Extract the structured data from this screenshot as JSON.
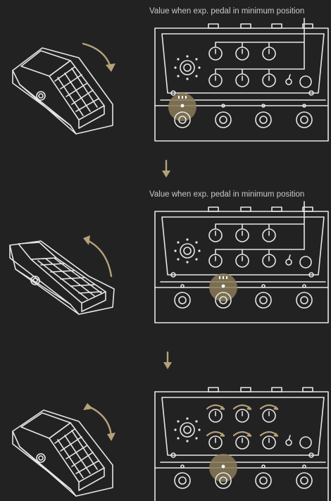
{
  "captions": [
    "Value when exp. pedal in minimum position",
    "Value when exp. pedal in minimum position"
  ],
  "colors": {
    "background": "#222222",
    "line": "#e6e6e6",
    "accent": "#b5a27a",
    "accent_fill": "#8a7a58"
  },
  "steps": [
    {
      "pedal": "toe-up",
      "pedal_arrow": "clockwise",
      "footswitch_active": 1,
      "caption": true
    },
    {
      "pedal": "toe-down",
      "pedal_arrow": "counter-clockwise",
      "footswitch_active": 2,
      "caption": true
    },
    {
      "pedal": "toe-up",
      "pedal_arrow": "bidirectional",
      "footswitch_active": 2,
      "caption": false
    }
  ]
}
